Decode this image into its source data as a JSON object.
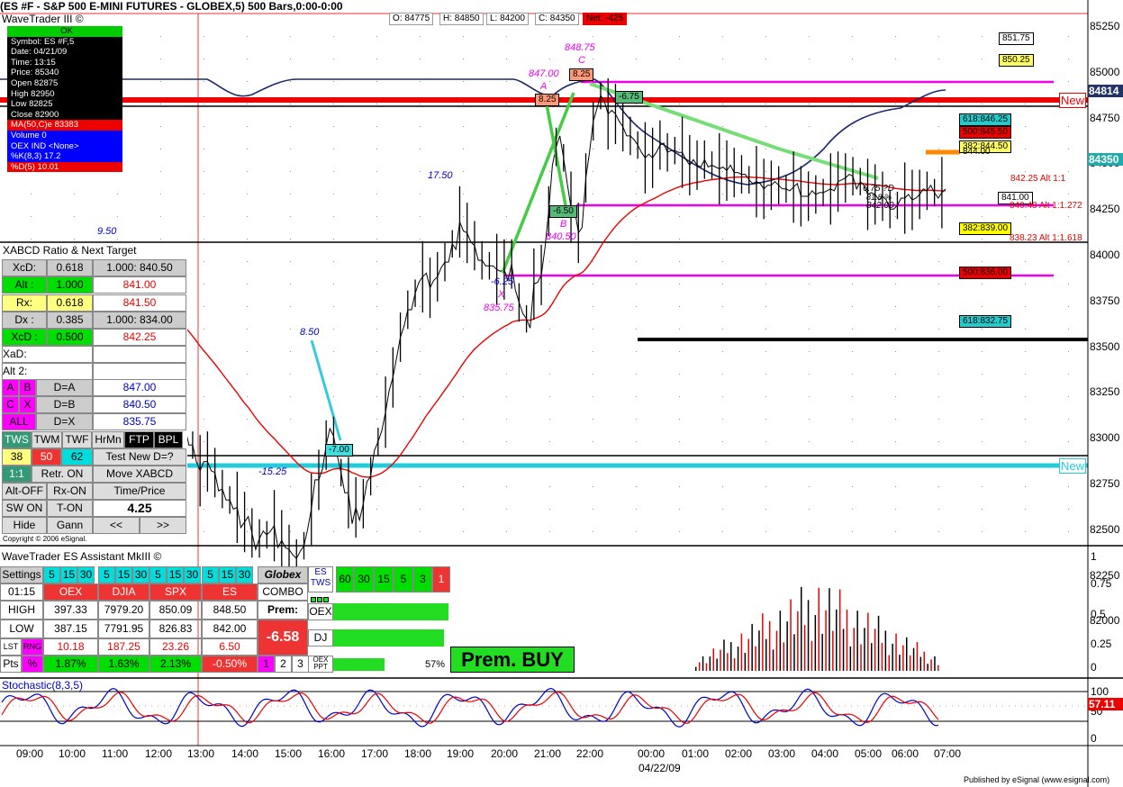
{
  "header": {
    "title": "(ES #F - S&P 500 E-MINI FUTURES - GLOBEX,5) 500 Bars,0:00-0:00",
    "app": "WaveTrader III ©",
    "open": "O: 84775",
    "high": "H: 84850",
    "low": "L: 84200",
    "close": "C: 84350",
    "net": "Net: -425"
  },
  "info": {
    "ok": "OK",
    "symbol": "Symbol: ES #F,5",
    "date": "Date: 04/21/09",
    "time": "Time: 13:15",
    "price": "Price: 85340",
    "open": "Open 82875",
    "high": "High 82950",
    "low": "Low 82825",
    "close": "Close 82900",
    "ma": "MA(50,C)e 83383",
    "volume": "Volume 0",
    "oex": "OEX IND <None>",
    "k": "%K(8,3) 17.2",
    "d": "%D(5) 10.01"
  },
  "axis": {
    "right": [
      "85250",
      "85000",
      "84750",
      "84500",
      "84250",
      "84000",
      "83750",
      "83500",
      "83250",
      "83000",
      "82750",
      "82500",
      "82250",
      "82000"
    ],
    "last": "84350",
    "cur": "84814",
    "time": [
      "09:00",
      "10:00",
      "11:00",
      "12:00",
      "13:00",
      "14:00",
      "15:00",
      "16:00",
      "17:00",
      "18:00",
      "19:00",
      "20:00",
      "21:00",
      "22:00",
      "00:00",
      "01:00",
      "02:00",
      "03:00",
      "04:00",
      "05:00",
      "06:00",
      "07:00"
    ],
    "date": "04/22/09",
    "vol": [
      "1",
      "0.75",
      "0.5",
      "0.25",
      "0"
    ],
    "stoch": [
      "100",
      "50",
      "0"
    ],
    "stochval": "57.11"
  },
  "pattern": {
    "a_price": "847.00",
    "a": "A",
    "a_box": "8.25",
    "c_price": "848.75",
    "c": "C",
    "c_box": "8.25",
    "x_box": "-6.25",
    "x": "X",
    "x_price": "835.75",
    "b_box": "-6.50",
    "b": "B",
    "b_price": "840.50",
    "d_box": "-6.75",
    "v950": "9.50",
    "v1750": "17.50",
    "v850": "8.50",
    "v700": "-7.00",
    "v1525": "-15.25",
    "d_lbl1": "6.75 ?D",
    "d_lbl2": "81.8 %",
    "d_lbl3": "842.00"
  },
  "levels": {
    "l8517": "851.75",
    "l8502": "850.25",
    "new_up": "New",
    "new_dn": "New",
    "f846": "618:846.25",
    "f845": "500:845.50",
    "f844": "382:844.50",
    "l844": "844.00",
    "alt1": "842.25 Alt 1:1",
    "l841": "841.00",
    "alt1272": "840.48 Alt 1:1.272",
    "f839": "382:839.00",
    "alt1618": "838.23 Alt 1:1.618",
    "f836": "500:836.00",
    "f832": "618:832.75"
  },
  "xabcd": {
    "title": "XABCD Ratio & Next Target",
    "r1": [
      "XcD:",
      "0.618",
      "1.000: 840.50"
    ],
    "r2": [
      "Alt :",
      "1.000",
      "841.00"
    ],
    "r3": [
      "Rx:",
      "0.618",
      "841.50"
    ],
    "r4": [
      "Dx :",
      "0.385",
      "1.000: 834.00"
    ],
    "r5": [
      "XcD :",
      "0.500",
      "842.25"
    ],
    "xad": "XaD:",
    "alt2": "Alt 2:",
    "ab": [
      "A",
      "B",
      "D=A",
      "847.00"
    ],
    "cx": [
      "C",
      "X",
      "D=B",
      "840.50"
    ],
    "all": [
      "ALL",
      "D=X",
      "835.75"
    ],
    "tabs": [
      "TWS",
      "TWM",
      "TWF",
      "HrMn",
      "FTP",
      "BPL"
    ],
    "n": [
      "38",
      "50",
      "62",
      "Test New D=?"
    ],
    "r11": [
      "1:1",
      "Retr. ON",
      "Move XABCD"
    ],
    "r12": [
      "Alt-OFF",
      "Rx-ON",
      "Time/Price"
    ],
    "r13": [
      "SW ON",
      "T-ON",
      "4.25"
    ],
    "r14": [
      "Hide",
      "Gann",
      "<<",
      ">>"
    ],
    "copy": "Copyright © 2006 eSignal."
  },
  "assistant": {
    "title": "WaveTrader ES Assistant MkIII ©",
    "settings": "Settings",
    "periods": [
      "5",
      "15",
      "30"
    ],
    "time": "01:15",
    "cols": [
      "OEX",
      "DJIA",
      "SPX",
      "ES"
    ],
    "globex": "Globex",
    "combo": "COMBO",
    "prem": "Prem:",
    "premval": "-6.58",
    "high": [
      "HIGH",
      "397.33",
      "7979.20",
      "850.09",
      "848.50"
    ],
    "low": [
      "LOW",
      "387.15",
      "7791.95",
      "826.83",
      "842.00"
    ],
    "lst": [
      "LST",
      "RNG",
      "10.18",
      "187.25",
      "23.26",
      "6.50"
    ],
    "pts": [
      "Pts",
      "%",
      "1.87%",
      "1.63%",
      "2.13%",
      "-0.50%"
    ],
    "nums": [
      "1",
      "2",
      "3"
    ],
    "estws": "ES TWS",
    "tws": [
      "60",
      "30",
      "15",
      "5",
      "3",
      "1"
    ],
    "oex": "OEX",
    "dj": "DJ",
    "oexppt": "OEX PPT",
    "pct": "57%",
    "buy": "Prem. BUY"
  },
  "stoch": {
    "title": "Stochastic(8,3,5)"
  },
  "footer": "Published by eSignal (www.esignal.com)",
  "chart_data": {
    "type": "line",
    "title": "(ES #F - S&P 500 E-MINI FUTURES - GLOBEX,5) 500 Bars,0:00-0:00",
    "ylim": [
      819.5,
      854
    ],
    "x": [
      0,
      1,
      2,
      3,
      4,
      5,
      6,
      7,
      8,
      9,
      10,
      11,
      12,
      13,
      14,
      15,
      16,
      17,
      18,
      19,
      20,
      21,
      22,
      23,
      24,
      25,
      26,
      27,
      28,
      29,
      30,
      31,
      32,
      33,
      34,
      35,
      36,
      37,
      38,
      39,
      40,
      41,
      42,
      43,
      44,
      45,
      46,
      47,
      48,
      49,
      50,
      51,
      52,
      53,
      54,
      55,
      56,
      57,
      58,
      59,
      60,
      61,
      62,
      63,
      64,
      65,
      66,
      67,
      68,
      69,
      70,
      71,
      72,
      73,
      74,
      75,
      76,
      77,
      78,
      79,
      80,
      81,
      82,
      83,
      84,
      85,
      86,
      87,
      88,
      89,
      90,
      91,
      92,
      93,
      94,
      95,
      96,
      97,
      98,
      99,
      100,
      101,
      102,
      103,
      104,
      105,
      106,
      107,
      108,
      109,
      110,
      111,
      112,
      113,
      114,
      115,
      116,
      117,
      118,
      119,
      120,
      121,
      122,
      123,
      124,
      125,
      126,
      127,
      128,
      129,
      130,
      131,
      132,
      133,
      134,
      135,
      136,
      137,
      138,
      139,
      140,
      141,
      142,
      143,
      144,
      145,
      146,
      147,
      148,
      149,
      150,
      151,
      152,
      153,
      154,
      155,
      156,
      157,
      158,
      159,
      160,
      161,
      162,
      163,
      164,
      165,
      166,
      167,
      168,
      169,
      170,
      171,
      172,
      173,
      174,
      175,
      176,
      177,
      178,
      179,
      180,
      181,
      182,
      183,
      184,
      185,
      186,
      187,
      188,
      189,
      190,
      191,
      192,
      193,
      194,
      195,
      196,
      197,
      198,
      199,
      200,
      201,
      202,
      203,
      204,
      205,
      206,
      207,
      208,
      209,
      210,
      211,
      212,
      213,
      214,
      215,
      216,
      217,
      218,
      219,
      220,
      221,
      222,
      223,
      224,
      225,
      226,
      227,
      228,
      229,
      230,
      231,
      232,
      233,
      234,
      235,
      236,
      237,
      238,
      239,
      240,
      241,
      242,
      243,
      244,
      245,
      246,
      247,
      248,
      249,
      250
    ],
    "series": [
      {
        "values": [
          836.2,
          835.8,
          836.7,
          836.4,
          836.2,
          835.8,
          835.5,
          835.6,
          835.6,
          834.5,
          834.6,
          834.8,
          835.8,
          835.5,
          835.1,
          836.0,
          836.7,
          836.1,
          837.2,
          837.8,
          837.0,
          837.8,
          838.0,
          837.6,
          837.4,
          837.0,
          837.1,
          836.8,
          836.8,
          836.9,
          837.4,
          837.1,
          837.4,
          837.4,
          837.4,
          837.5,
          837.5,
          837.7,
          838.4,
          838.0,
          837.0,
          836.4,
          836.0,
          835.1,
          835.9,
          834.4,
          833.0,
          832.0,
          830.5,
          829.6,
          829.6,
          828.7,
          828.2,
          828.7,
          828.7,
          828.2,
          828.1,
          827.1,
          827.2,
          826.6,
          826.6,
          826.1,
          826.2,
          825.1,
          825.4,
          825.7,
          824.8,
          823.9,
          824.5,
          824.9,
          824.7,
          824.9,
          825.2,
          824.0,
          824.4,
          824.0,
          823.9,
          823.6,
          823.4,
          823.8,
          824.1,
          825.0,
          826.1,
          827.7,
          827.7,
          828.3,
          829.6,
          830.5,
          830.1,
          829.0,
          828.1,
          827.0,
          827.0,
          825.3,
          826.2,
          825.5,
          826.4,
          827.6,
          827.9,
          829.3,
          829.8,
          830.4,
          831.4,
          832.6,
          833.3,
          834.4,
          835.5,
          836.1,
          837.0,
          837.0,
          837.9,
          838.5,
          838.8,
          839.0,
          838.2,
          838.6,
          838.8,
          839.3,
          839.6,
          839.6,
          840.6,
          840.3,
          841.8,
          841.3,
          841.2,
          840.7,
          840.5,
          839.7,
          839.7,
          839.4,
          839.4,
          839.4,
          839.2,
          839.1,
          839.2,
          838.6,
          839.5,
          838.1,
          837.4,
          836.8,
          836.5,
          836.0,
          838.4,
          838.5,
          838.9,
          840.4,
          842.4,
          844.9,
          845.9,
          846.5,
          845.3,
          843.9,
          842.6,
          842.5,
          841.2,
          841.5,
          844.2,
          845.6,
          847.3,
          848.0,
          848.7,
          848.4,
          847.7,
          847.9,
          847.7,
          847.3,
          847.0,
          846.5,
          846.5,
          846.3,
          846.0,
          845.6,
          845.3,
          845.5,
          845.3,
          845.6,
          846.0,
          846.1,
          845.6,
          845.7,
          845.7,
          845.6,
          845.6,
          845.2,
          844.9,
          845.2,
          844.9,
          844.8,
          845.2,
          844.8,
          844.9,
          844.8,
          844.7,
          844.8,
          844.6,
          844.9,
          844.5,
          844.5,
          844.4,
          844.4,
          844.1,
          843.9,
          844.0,
          843.9,
          843.6,
          843.8,
          843.8,
          844.0,
          843.8,
          843.6,
          843.6,
          843.5,
          843.7,
          843.9,
          843.2,
          843.2,
          843.2,
          843.5,
          843.3,
          843.4,
          843.4,
          843.5,
          843.6,
          843.5,
          844.0,
          844.1,
          844.2,
          844.4,
          844.3,
          843.6,
          844.0,
          843.8,
          843.3,
          843.4,
          843.3,
          843.0,
          843.2,
          843.0,
          842.5,
          842.5,
          842.7,
          843.1,
          843.1,
          843.3,
          843.0,
          843.1,
          843.3,
          843.6,
          843.5,
          843.8,
          843.4,
          843.1,
          843.4,
          843.6
        ]
      }
    ]
  }
}
